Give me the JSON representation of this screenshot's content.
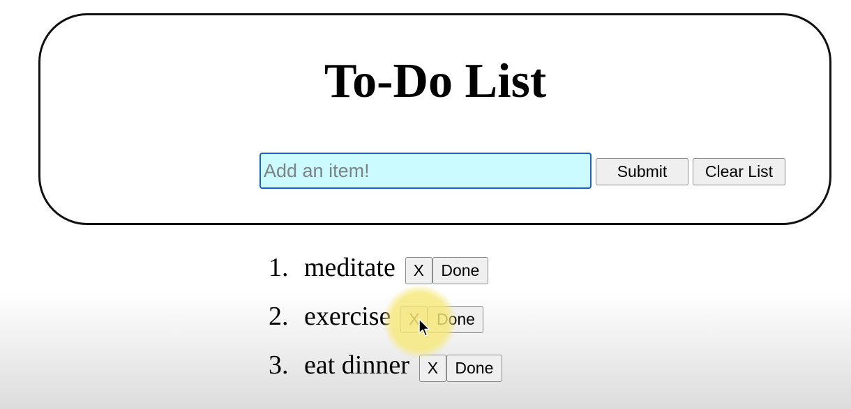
{
  "header": {
    "title": "To-Do List"
  },
  "form": {
    "input_value": "",
    "input_placeholder": "Add an item!",
    "submit_label": "Submit",
    "clear_label": "Clear List"
  },
  "todos": [
    {
      "number": "1.",
      "text": "meditate",
      "delete_label": "X",
      "done_label": "Done"
    },
    {
      "number": "2.",
      "text": "exercise",
      "delete_label": "X",
      "done_label": "Done"
    },
    {
      "number": "3.",
      "text": "eat dinner",
      "delete_label": "X",
      "done_label": "Done"
    }
  ],
  "icons": {
    "cursor": "mouse-pointer-icon"
  },
  "colors": {
    "input_background": "#ccfbff",
    "input_border": "#1a5fd0",
    "cursor_highlight": "#f6e878"
  }
}
